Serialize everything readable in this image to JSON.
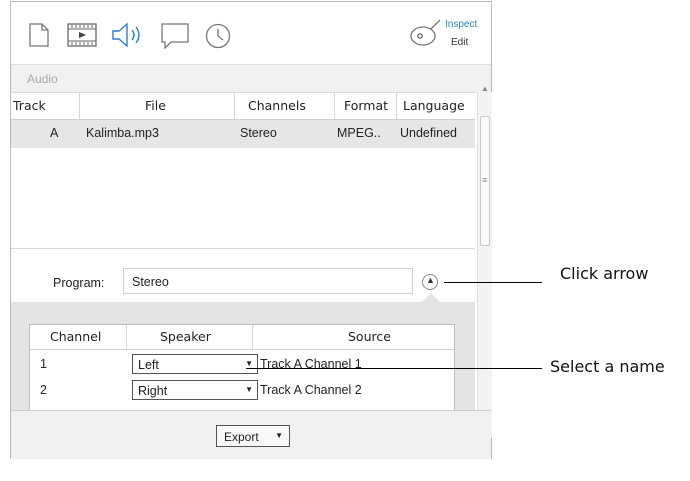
{
  "toolbar": {
    "icons": [
      "document-icon",
      "film-icon",
      "audio-icon",
      "comment-icon",
      "clock-icon"
    ],
    "inspect_label": "Inspect",
    "edit_label": "Edit",
    "accent": "#2a7fd4"
  },
  "section": {
    "title": "Audio"
  },
  "tracks": {
    "columns": [
      "Track",
      "File",
      "Channels",
      "Format",
      "Language"
    ],
    "rows": [
      {
        "track": "A",
        "file": "Kalimba.mp3",
        "channels": "Stereo",
        "format": "MPEG..",
        "language": "Undefined"
      }
    ]
  },
  "program": {
    "label": "Program:",
    "value": "Stereo"
  },
  "channel_table": {
    "columns": [
      "Channel",
      "Speaker",
      "Source"
    ],
    "rows": [
      {
        "channel": "1",
        "speaker": "Left",
        "source": "Track A Channel 1"
      },
      {
        "channel": "2",
        "speaker": "Right",
        "source": "Track A Channel 2"
      }
    ]
  },
  "footer": {
    "export_label": "Export"
  },
  "callouts": {
    "arrow": "Click arrow",
    "name": "Select a name"
  }
}
